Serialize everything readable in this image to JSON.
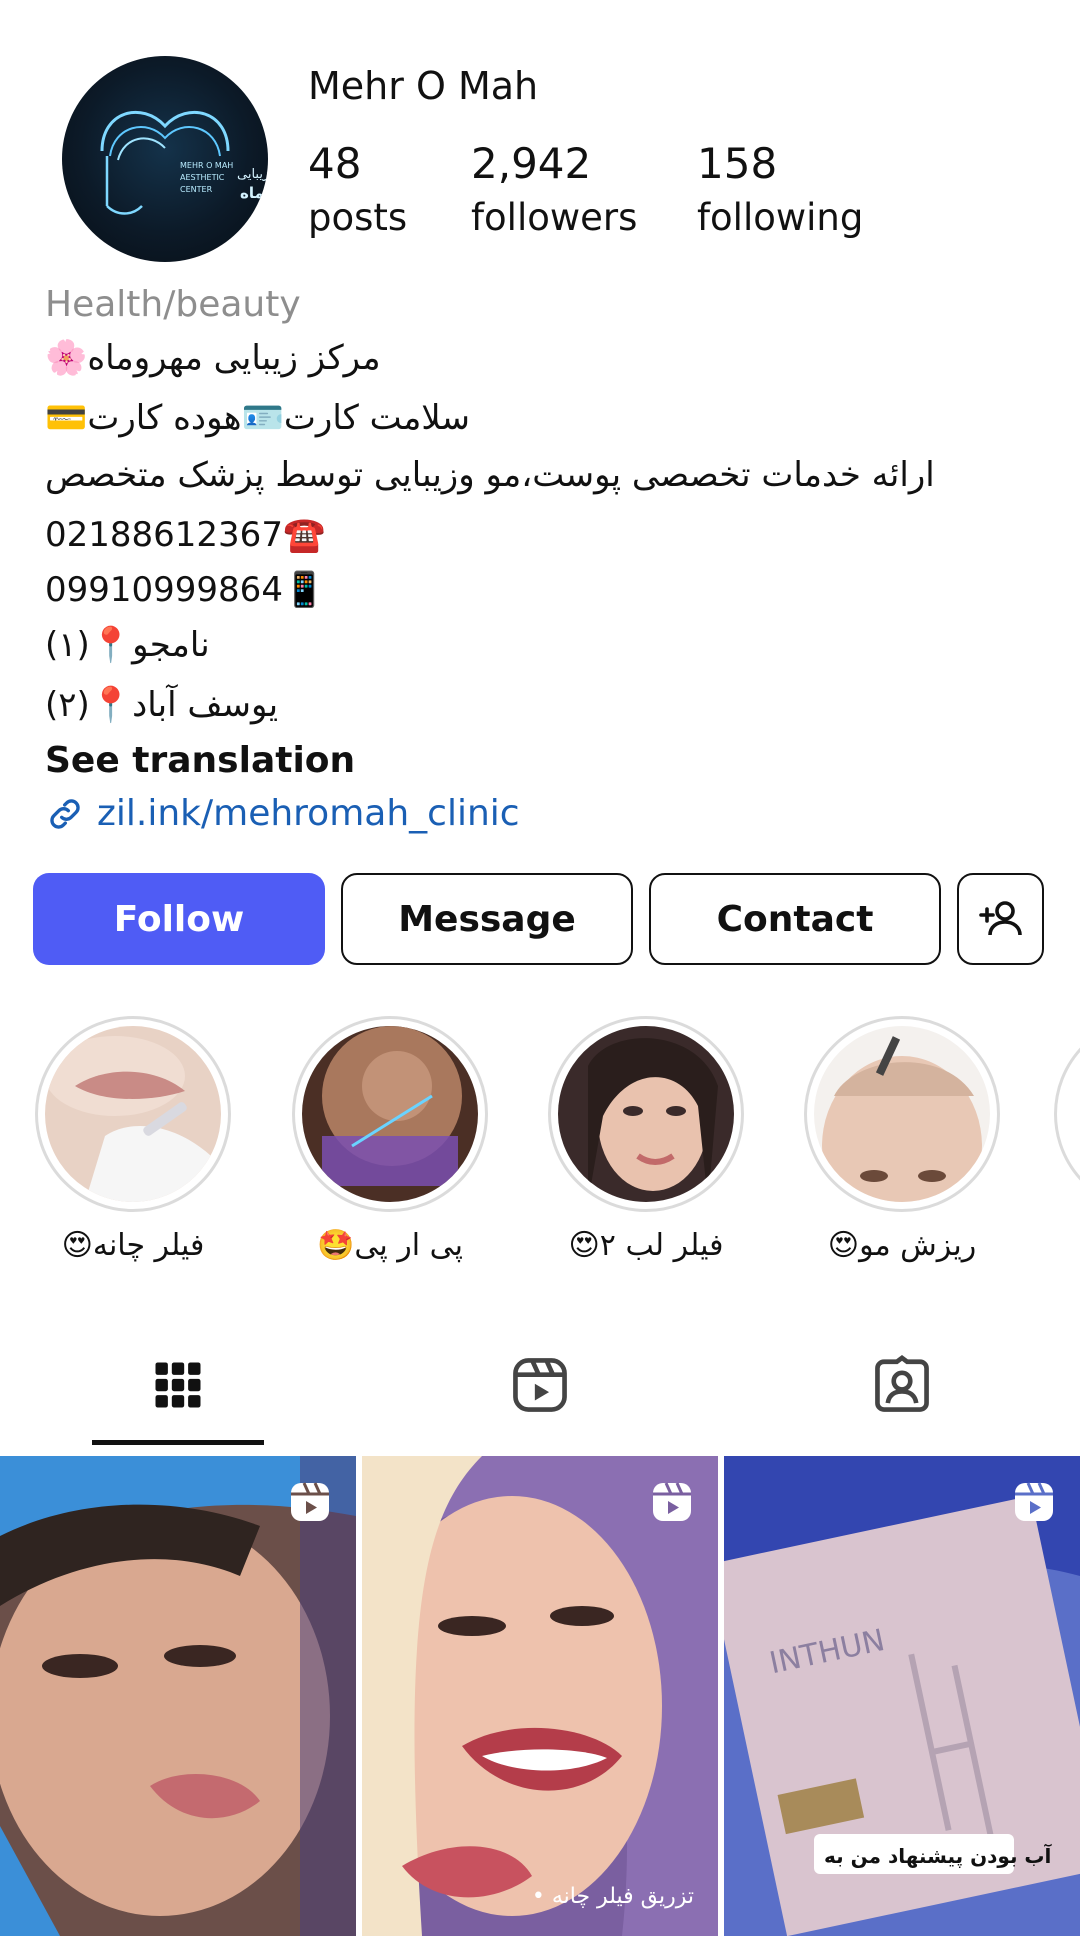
{
  "profile": {
    "name": "Mehr O Mah",
    "avatar_text_lines": [
      "MEHR O MAH",
      "AESTHETIC",
      "CENTER",
      "مرکز زیبایی",
      "مهروماه"
    ]
  },
  "stats": [
    {
      "value": "48",
      "label": "posts"
    },
    {
      "value": "2,942",
      "label": "followers"
    },
    {
      "value": "158",
      "label": "following"
    }
  ],
  "bio": {
    "category": "Health/beauty",
    "lines": [
      "مرکز زیبایی مهروماه🌸",
      "سلامت کارت🪪هوده کارت💳",
      "ارائه خدمات تخصصی پوست،مو وزیبایی توسط پزشک متخصص",
      "02188612367☎️",
      "09910999864📱",
      "نامجو📍(۱)",
      "یوسف آباد📍(۲)"
    ],
    "see_translation": "See translation",
    "link": "zil.ink/mehromah_clinic"
  },
  "actions": {
    "follow": "Follow",
    "message": "Message",
    "contact": "Contact"
  },
  "highlights": [
    {
      "label": "فیلر چانه😍"
    },
    {
      "label": "پی ار پی🤩"
    },
    {
      "label": "فیلر لب ۲😍"
    },
    {
      "label": "ریزش مو😍"
    }
  ],
  "tabs": [
    {
      "icon": "grid-icon"
    },
    {
      "icon": "reels-icon"
    },
    {
      "icon": "tagged-icon"
    }
  ],
  "posts": [
    {
      "type": "reel",
      "overlay": ""
    },
    {
      "type": "reel",
      "overlay": "تزریق فیلر چانه •"
    },
    {
      "type": "reel",
      "overlay": "آب بودن پیشنهاد من به"
    }
  ],
  "colors": {
    "follow_button": "#4f5cf5",
    "link": "#1a5fb4",
    "category": "#8e8e8e"
  }
}
